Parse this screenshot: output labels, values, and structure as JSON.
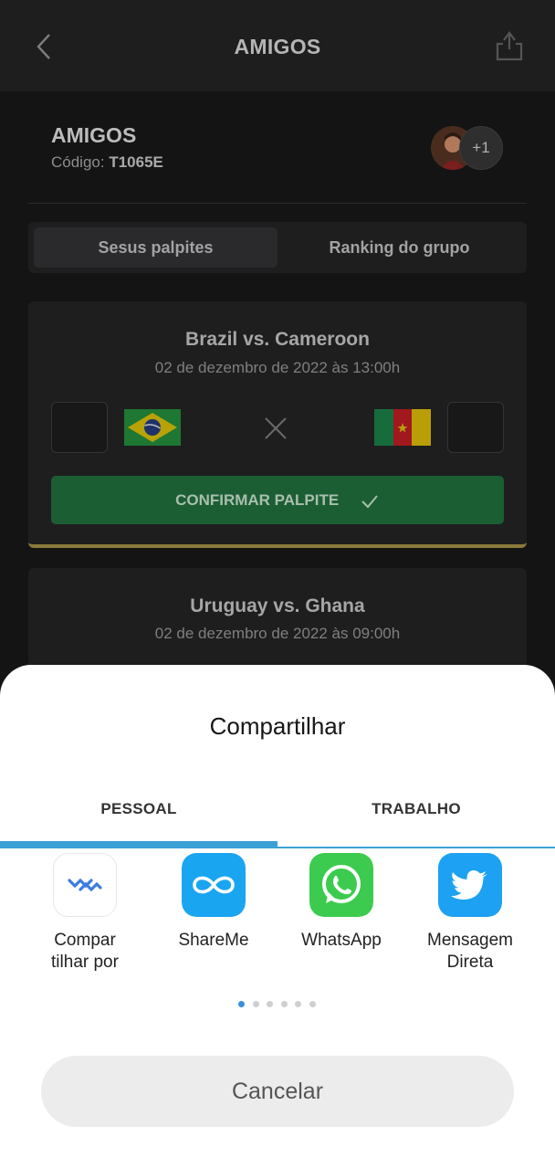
{
  "topbar": {
    "title": "AMIGOS",
    "back_icon": "chevron-left-icon",
    "share_icon": "share-icon"
  },
  "group": {
    "name": "AMIGOS",
    "code_label": "Código:",
    "code": "T1065E",
    "extra_members": "+1"
  },
  "tabs": [
    {
      "label": "Sesus palpites",
      "active": true
    },
    {
      "label": "Ranking do grupo",
      "active": false
    }
  ],
  "matches": [
    {
      "title": "Brazil vs. Cameroon",
      "date": "02 de dezembro de 2022 às 13:00h",
      "home_flag": "brazil-flag",
      "away_flag": "cameroon-flag",
      "confirm_label": "CONFIRMAR PALPITE"
    },
    {
      "title": "Uruguay vs. Ghana",
      "date": "02 de dezembro de 2022 às 09:00h"
    }
  ],
  "share_sheet": {
    "title": "Compartilhar",
    "tabs": [
      {
        "label": "PESSOAL",
        "active": true
      },
      {
        "label": "TRABALHO",
        "active": false
      }
    ],
    "apps": [
      {
        "label_line1": "Compar",
        "label_line2": "tilhar por",
        "icon": "share-via-icon"
      },
      {
        "label_line1": "ShareMe",
        "label_line2": "",
        "icon": "shareme-icon"
      },
      {
        "label_line1": "WhatsApp",
        "label_line2": "",
        "icon": "whatsapp-icon"
      },
      {
        "label_line1": "Mensagem",
        "label_line2": "Direta",
        "icon": "twitter-icon"
      }
    ],
    "page_indicator": {
      "pages": 6,
      "current": 1
    },
    "cancel_label": "Cancelar"
  },
  "colors": {
    "background": "#141414",
    "confirm_green": "#1c5e33",
    "card_accent": "#8a7a3c",
    "sheet_accent": "#3aa0d6"
  }
}
